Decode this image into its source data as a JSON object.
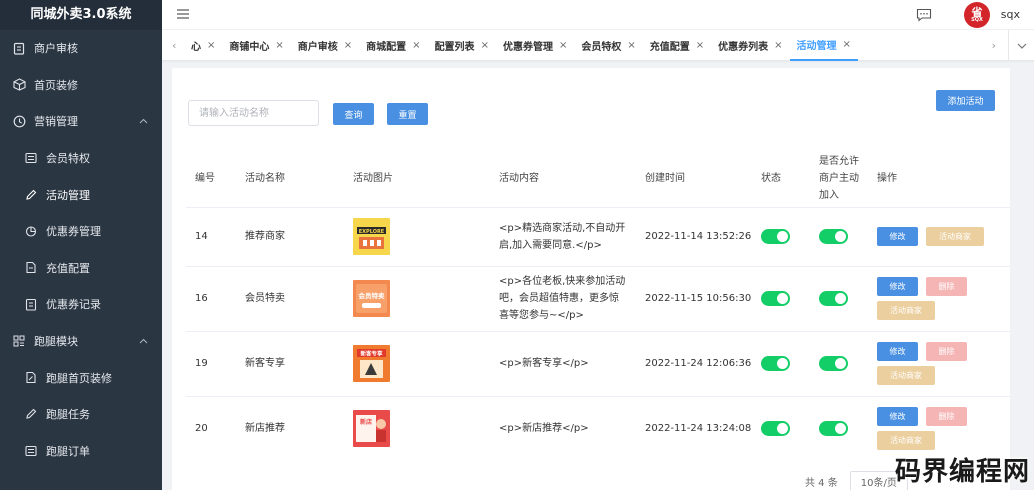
{
  "app": {
    "title": "同城外卖3.0系统"
  },
  "sidebar": {
    "items": [
      {
        "label": "商户审核",
        "icon": "clipboard-icon",
        "level": 0
      },
      {
        "label": "首页装修",
        "icon": "cube-icon",
        "level": 0
      },
      {
        "label": "营销管理",
        "icon": "clock-icon",
        "level": 0,
        "expanded": true
      },
      {
        "label": "会员特权",
        "icon": "list-icon",
        "level": 1
      },
      {
        "label": "活动管理",
        "icon": "edit-icon",
        "level": 1,
        "active": true
      },
      {
        "label": "优惠券管理",
        "icon": "pie-icon",
        "level": 1
      },
      {
        "label": "充值配置",
        "icon": "doc-icon",
        "level": 1
      },
      {
        "label": "优惠券记录",
        "icon": "clipboard-icon",
        "level": 1
      },
      {
        "label": "跑腿模块",
        "icon": "grid-icon",
        "level": 0,
        "expanded": true
      },
      {
        "label": "跑腿首页装修",
        "icon": "doc-edit-icon",
        "level": 1
      },
      {
        "label": "跑腿任务",
        "icon": "edit-icon",
        "level": 1
      },
      {
        "label": "跑腿订单",
        "icon": "list-icon",
        "level": 1
      }
    ]
  },
  "header": {
    "username": "sqx",
    "avatar_line1": "省",
    "avatar_line2": "SQX"
  },
  "tabs": {
    "prev": "‹",
    "partial": "心",
    "items": [
      {
        "label": "商铺中心",
        "active": false
      },
      {
        "label": "商户审核",
        "active": false
      },
      {
        "label": "商城配置",
        "active": false
      },
      {
        "label": "配置列表",
        "active": false
      },
      {
        "label": "优惠券管理",
        "active": false
      },
      {
        "label": "会员特权",
        "active": false
      },
      {
        "label": "充值配置",
        "active": false
      },
      {
        "label": "优惠券列表",
        "active": false
      },
      {
        "label": "活动管理",
        "active": true
      }
    ],
    "next": "›",
    "close": "×"
  },
  "search": {
    "placeholder": "请输入活动名称",
    "value": "",
    "query_label": "查询",
    "reset_label": "重置",
    "add_label": "添加活动"
  },
  "table": {
    "headers": {
      "id": "编号",
      "name": "活动名称",
      "image": "活动图片",
      "content": "活动内容",
      "created": "创建时间",
      "status": "状态",
      "allow_1": "是否允许",
      "allow_2": "商户主动",
      "allow_3": "加入",
      "ops": "操作"
    },
    "rows": [
      {
        "id": "14",
        "name": "推荐商家",
        "content_1": "<p>精选商家活动,不自动开",
        "content_2": "启,加入需要同意.</p>",
        "content_3": "",
        "created": "2022-11-14 13:52:26",
        "image_text": "EXPLORE"
      },
      {
        "id": "16",
        "name": "会员特卖",
        "content_1": "<p>各位老板,快来参加活动",
        "content_2": "吧，会员超值特惠，更多惊",
        "content_3": "喜等您参与~</p>",
        "created": "2022-11-15 10:56:30",
        "image_text": "会员特卖"
      },
      {
        "id": "19",
        "name": "新客专享",
        "content_1": "<p>新客专享</p>",
        "content_2": "",
        "content_3": "",
        "created": "2022-11-24 12:06:36",
        "image_text": "新客专享"
      },
      {
        "id": "20",
        "name": "新店推荐",
        "content_1": "<p>新店推荐</p>",
        "content_2": "",
        "content_3": "",
        "created": "2022-11-24 13:24:08",
        "image_text": "新店"
      }
    ],
    "op_labels": {
      "edit": "修改",
      "delete": "删除",
      "activity_merchants": "活动商家"
    }
  },
  "pager": {
    "total": "共 4 条",
    "page_size": "10条/页"
  },
  "watermark": "码界编程网",
  "colors": {
    "primary": "#4a90e2",
    "switch_on": "#13ce66",
    "danger_light": "#f5b5b5",
    "warning_light": "#ebcf9f",
    "sidebar_bg": "#2b3643"
  }
}
